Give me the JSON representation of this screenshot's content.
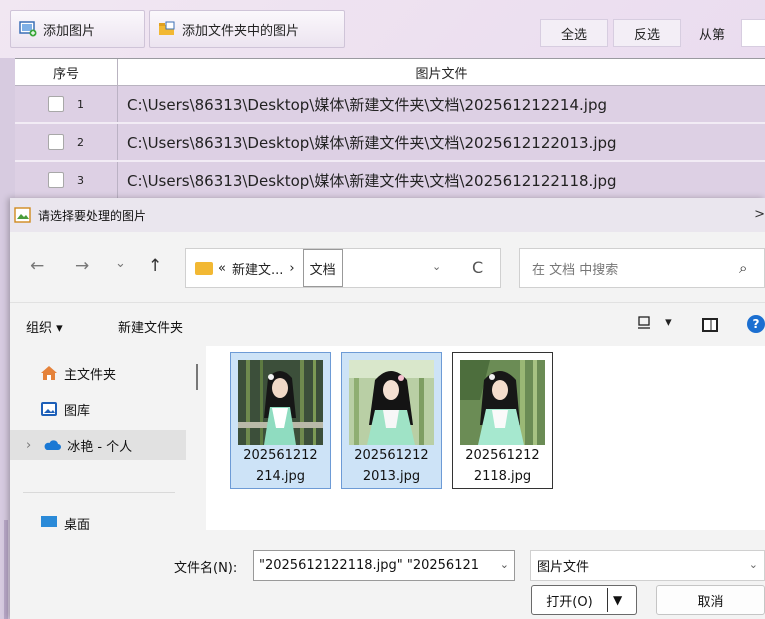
{
  "app": {
    "add_images_label": "添加图片",
    "add_folder_label": "添加文件夹中的图片",
    "select_all_label": "全选",
    "invert_label": "反选",
    "from_label": "从第",
    "table": {
      "col_index": "序号",
      "col_file": "图片文件",
      "rows": [
        {
          "index": "1",
          "path": "C:\\Users\\86313\\Desktop\\媒体\\新建文件夹\\文档\\202561212214.jpg"
        },
        {
          "index": "2",
          "path": "C:\\Users\\86313\\Desktop\\媒体\\新建文件夹\\文档\\2025612122013.jpg"
        },
        {
          "index": "3",
          "path": "C:\\Users\\86313\\Desktop\\媒体\\新建文件夹\\文档\\2025612122118.jpg"
        }
      ]
    }
  },
  "dialog": {
    "title": "请选择要处理的图片",
    "close_glyph": ">",
    "nav": {
      "back": "←",
      "forward": "→",
      "history": "⌄",
      "up": "↑",
      "refresh": "C"
    },
    "address": {
      "overflow": "«",
      "segment": "新建文...",
      "sep": "›",
      "current": "文档",
      "dropdown": "⌄"
    },
    "search_placeholder": "在 文档 中搜索",
    "toolbar": {
      "organize": "组织 ▾",
      "new_folder": "新建文件夹",
      "view": "▾",
      "help": "?"
    },
    "sidebar": [
      {
        "label": "主文件夹",
        "icon": "home-icon"
      },
      {
        "label": "图库",
        "icon": "gallery-icon"
      },
      {
        "label": "冰艳 - 个人",
        "icon": "cloud-icon",
        "selected": true
      },
      {
        "label": "桌面",
        "icon": "desktop-icon"
      }
    ],
    "expand_glyph": "›",
    "files": [
      {
        "name_line1": "202561212",
        "name_line2": "214.jpg",
        "selected": true
      },
      {
        "name_line1": "202561212",
        "name_line2": "2013.jpg",
        "selected": true
      },
      {
        "name_line1": "202561212",
        "name_line2": "2118.jpg",
        "selected": true,
        "focused": true
      }
    ],
    "filename_label": "文件名(N):",
    "filename_value": "\"2025612122118.jpg\" \"20256121",
    "filetype_value": "图片文件",
    "open_label": "打开(O)",
    "cancel_label": "取消"
  },
  "colors": {
    "selection_fill": "#cde3f7",
    "selection_border": "#6d9bd6",
    "row_bg": "#ddd0e4",
    "folder": "#f2b833",
    "accent_blue": "#1b6fd1"
  }
}
